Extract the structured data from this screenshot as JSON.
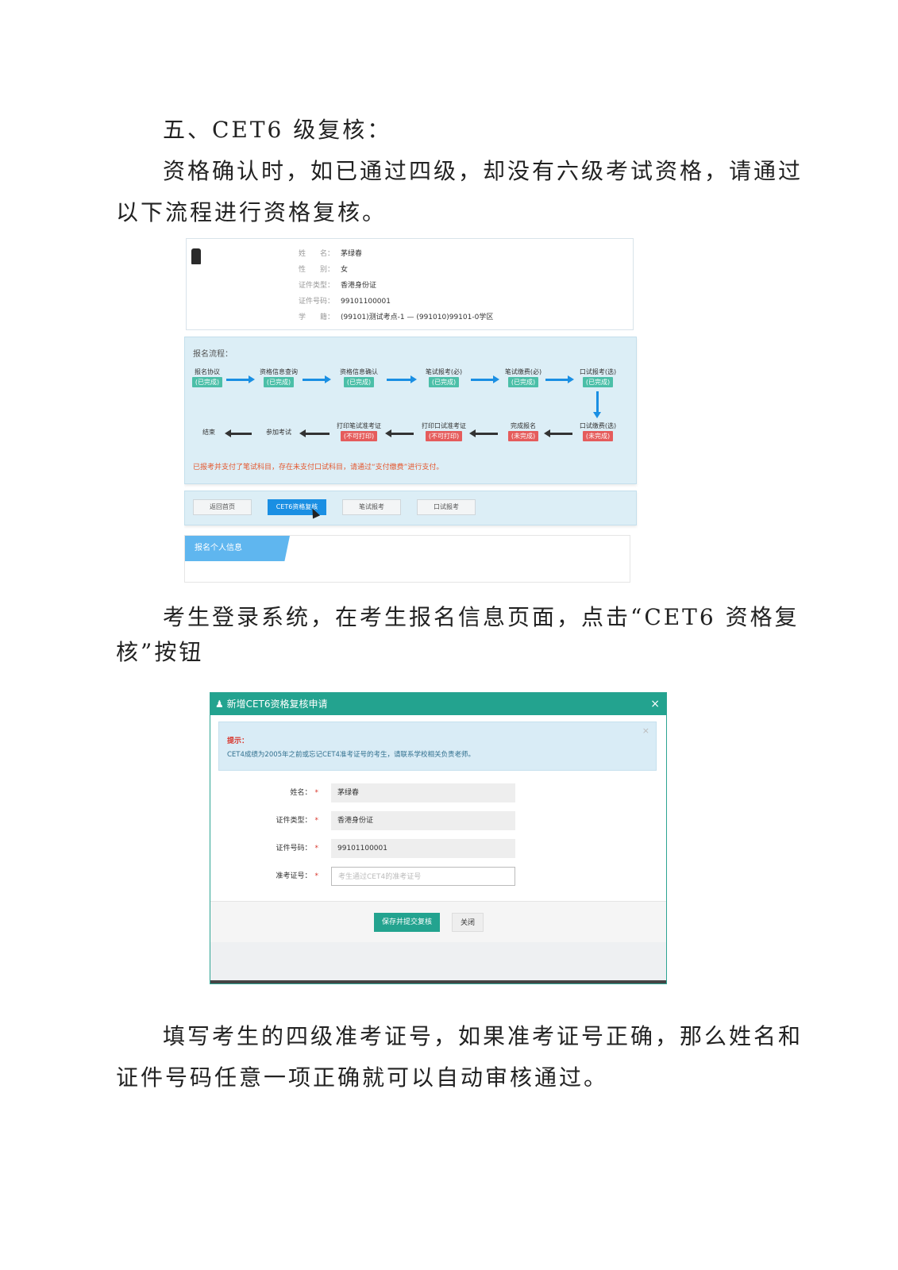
{
  "heading": "五、CET6 级复核：",
  "intro_line1": "资格确认时，如已通过四级，却没有六级考试资格，请通过",
  "intro_line2": "以下流程进行资格复核。",
  "profile": {
    "rows": [
      {
        "label": "姓　　名：",
        "value": "茅绿春"
      },
      {
        "label": "性　　别：",
        "value": "女"
      },
      {
        "label": "证件类型：",
        "value": "香港身份证"
      },
      {
        "label": "证件号码：",
        "value": "99101100001"
      },
      {
        "label": "学　　籍：",
        "value": "(99101)测试考点-1 — (991010)99101-0学区"
      }
    ]
  },
  "flow": {
    "title": "报名流程：",
    "top_steps": [
      {
        "label": "报名协议",
        "status": "(已完成)"
      },
      {
        "label": "资格信息查询",
        "status": "(已完成)"
      },
      {
        "label": "资格信息确认",
        "status": "(已完成)"
      },
      {
        "label": "笔试报考(必)",
        "status": "(已完成)"
      },
      {
        "label": "笔试缴费(必)",
        "status": "(已完成)"
      },
      {
        "label": "口试报考(选)",
        "status": "(已完成)"
      }
    ],
    "bottom_steps": [
      {
        "label": "结束",
        "status": ""
      },
      {
        "label": "参加考试",
        "status": ""
      },
      {
        "label": "打印笔试准考证",
        "status": "(不可打印)"
      },
      {
        "label": "打印口试准考证",
        "status": "(不可打印)"
      },
      {
        "label": "完成报名",
        "status": "(未完成)"
      },
      {
        "label": "口试缴费(选)",
        "status": "(未完成)"
      }
    ],
    "warning": "已报考并支付了笔试科目，存在未支付口试科目，请通过“支付缴费”进行支付。"
  },
  "buttons": {
    "home": "返回首页",
    "cet6_review": "CET6资格复核",
    "written": "笔试报考",
    "oral": "口试报考"
  },
  "info_tab": "报名个人信息",
  "caption1_line1": "考生登录系统，在考生报名信息页面，点击“CET6 资格复",
  "caption1_line2": "核”按钮",
  "modal": {
    "title": "新增CET6资格复核申请",
    "close_glyph": "×",
    "tip_title": "提示：",
    "tip_body": "CET4成绩为2005年之前或忘记CET4准考证号的考生，请联系学校相关负责老师。",
    "tip_close": "×",
    "fields": [
      {
        "label": "姓名：",
        "value": "茅绿春"
      },
      {
        "label": "证件类型：",
        "value": "香港身份证"
      },
      {
        "label": "证件号码：",
        "value": "99101100001"
      }
    ],
    "ticket_label": "准考证号：",
    "ticket_placeholder": "考生通过CET4的准考证号",
    "required_mark": "*",
    "save_button": "保存并提交复核",
    "close_button": "关闭"
  },
  "caption2_line1": "填写考生的四级准考证号，如果准考证号正确，那么姓名和",
  "caption2_line2": "证件号码任意一项正确就可以自动审核通过。",
  "colors": {
    "flow_bg": "#dceef6",
    "done_badge": "#4bbfa8",
    "todo_badge": "#e55c5c",
    "primary_blue": "#1a8fe3",
    "modal_teal": "#23a38f"
  }
}
